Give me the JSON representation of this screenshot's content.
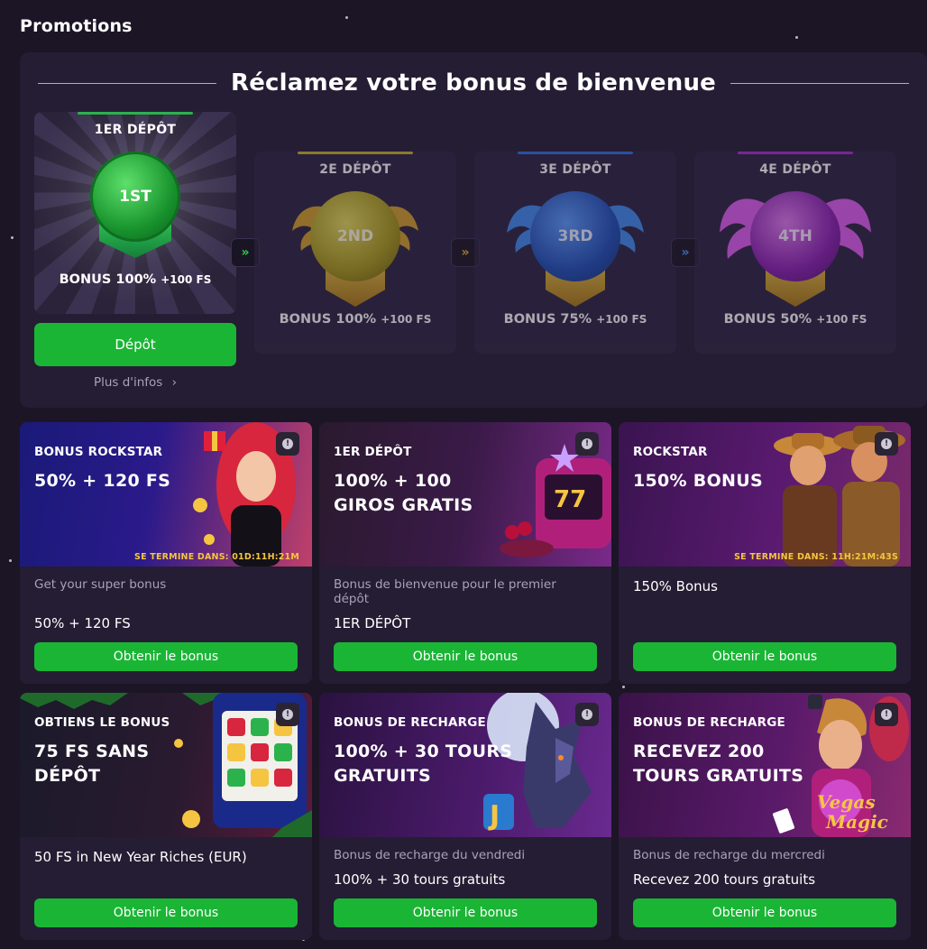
{
  "page": {
    "title": "Promotions"
  },
  "welcome": {
    "title": "Réclamez votre bonus de bienvenue",
    "deposits": [
      {
        "label": "1ER DÉPÔT",
        "medal": "1ST",
        "bonus_main": "BONUS 100%",
        "bonus_extra": "+100 FS",
        "color": "#2bb24c"
      },
      {
        "label": "2E DÉPÔT",
        "medal": "2ND",
        "bonus_main": "BONUS 100%",
        "bonus_extra": "+100 FS",
        "color": "#c8b52a"
      },
      {
        "label": "3E DÉPÔT",
        "medal": "3RD",
        "bonus_main": "BONUS 75%",
        "bonus_extra": "+100 FS",
        "color": "#2f6fe0"
      },
      {
        "label": "4E DÉPÔT",
        "medal": "4TH",
        "bonus_main": "BONUS 50%",
        "bonus_extra": "+100 FS",
        "color": "#b02ad0"
      }
    ],
    "deposit_button": "Dépôt",
    "more_info": "Plus d'infos",
    "arrow_icon": "»"
  },
  "promos": [
    {
      "kicker": "BONUS ROCKSTAR",
      "headline": "50% + 120 FS",
      "timer": "SE TERMINE DANS: 01D:11H:21M",
      "description": "Get your super bonus",
      "value": "50% + 120 FS",
      "cta": "Obtenir le bonus"
    },
    {
      "kicker": "1ER DÉPÔT",
      "headline": "100% + 100 GIROS GRATIS",
      "timer": "",
      "description": "Bonus de bienvenue pour le premier dépôt",
      "value": "1ER DÉPÔT",
      "cta": "Obtenir le bonus"
    },
    {
      "kicker": "ROCKSTAR",
      "headline": "150% BONUS",
      "timer": "SE TERMINE DANS: 11H:21M:43S",
      "description": "150% Bonus",
      "value": "",
      "cta": "Obtenir le bonus"
    },
    {
      "kicker": "OBTIENS LE BONUS",
      "headline": "75 FS SANS DÉPÔT",
      "timer": "",
      "description": "50 FS in New Year Riches (EUR)",
      "value": "",
      "cta": "Obtenir le bonus"
    },
    {
      "kicker": "BONUS DE RECHARGE",
      "headline": "100% + 30 TOURS GRATUITS",
      "timer": "",
      "description": "Bonus de recharge du vendredi",
      "value": "100% + 30 tours gratuits",
      "cta": "Obtenir le bonus"
    },
    {
      "kicker": "BONUS DE RECHARGE",
      "headline": "RECEVEZ 200 TOURS GRATUITS",
      "timer": "",
      "description": "Bonus de recharge du mercredi",
      "value": "Recevez 200 tours gratuits",
      "cta": "Obtenir le bonus"
    }
  ],
  "art_text": {
    "vegas_magic": "Vegas Magic"
  },
  "colors": {
    "accent_green": "#1ab535",
    "timer_yellow": "#f5c542",
    "panel": "#251d33",
    "background": "#1c1526"
  }
}
